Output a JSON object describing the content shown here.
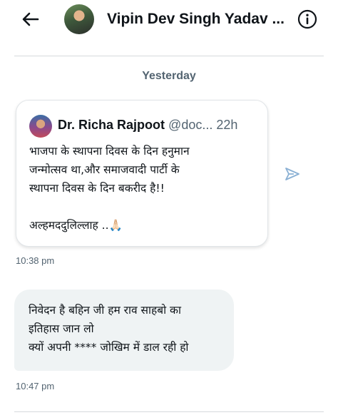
{
  "header": {
    "title": "Vipin Dev Singh Yadav ...",
    "back_icon": "arrow-left-icon",
    "info_icon": "info-circle-icon"
  },
  "conversation": {
    "day_label": "Yesterday",
    "messages": [
      {
        "type": "quoted_post",
        "quote": {
          "name": "Dr. Richa Rajpoot",
          "handle": "@doc...",
          "age": "22h",
          "text": "भाजपा के स्थापना दिवस के दिन हनुमान\nजन्मोत्सव था,और समाजवादी पार्टी के\nस्थापना दिवस के दिन बकरीद है!!\n\nअल्हमददुलिल्लाह ..🙏🏻"
        },
        "time": "10:38 pm"
      },
      {
        "type": "text",
        "text": "निवेदन है बहिन जी हम राव साहबो का\nइतिहास जान लो\nक्यों अपनी **** जोखिम में डाल रही हो",
        "time": "10:47 pm"
      }
    ]
  },
  "colors": {
    "text_primary": "#0f1419",
    "text_secondary": "#536471",
    "bubble_bg": "#eff3f4",
    "divider": "#d6d9dc",
    "send_icon": "#8ab0d4"
  }
}
